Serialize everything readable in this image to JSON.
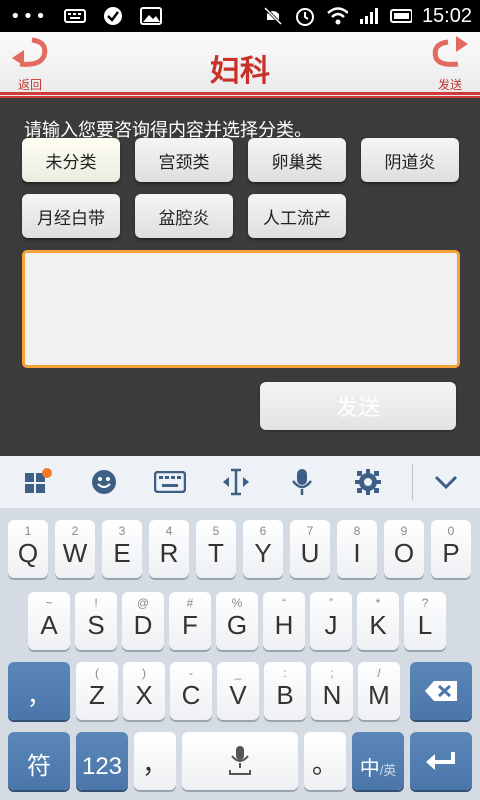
{
  "status_bar": {
    "time": "15:02",
    "dots": "•••"
  },
  "header": {
    "title": "妇科",
    "back_label": "返回",
    "send_label": "发送"
  },
  "main": {
    "prompt": "请输入您要咨询得内容并选择分类。",
    "categories": [
      "未分类",
      "宫颈类",
      "卵巢类",
      "阴道炎",
      "月经白带",
      "盆腔炎",
      "人工流产"
    ],
    "send_button": "发送",
    "input_value": ""
  },
  "keyboard": {
    "row1": [
      {
        "m": "Q",
        "s": "1"
      },
      {
        "m": "W",
        "s": "2"
      },
      {
        "m": "E",
        "s": "3"
      },
      {
        "m": "R",
        "s": "4"
      },
      {
        "m": "T",
        "s": "5"
      },
      {
        "m": "Y",
        "s": "6"
      },
      {
        "m": "U",
        "s": "7"
      },
      {
        "m": "I",
        "s": "8"
      },
      {
        "m": "O",
        "s": "9"
      },
      {
        "m": "P",
        "s": "0"
      }
    ],
    "row2": [
      {
        "m": "A",
        "s": "~"
      },
      {
        "m": "S",
        "s": "!"
      },
      {
        "m": "D",
        "s": "@"
      },
      {
        "m": "F",
        "s": "#"
      },
      {
        "m": "G",
        "s": "%"
      },
      {
        "m": "H",
        "s": "“"
      },
      {
        "m": "J",
        "s": "”"
      },
      {
        "m": "K",
        "s": "*"
      },
      {
        "m": "L",
        "s": "?"
      }
    ],
    "row3": [
      {
        "m": "Z",
        "s": "("
      },
      {
        "m": "X",
        "s": ")"
      },
      {
        "m": "C",
        "s": "-"
      },
      {
        "m": "V",
        "s": "_"
      },
      {
        "m": "B",
        "s": ":"
      },
      {
        "m": "N",
        "s": ";"
      },
      {
        "m": "M",
        "s": "/"
      }
    ],
    "comma_key": "，",
    "symbols_key": "符",
    "numbers_key": "123",
    "comma2_key": "，",
    "period_key": "。",
    "lang_key": "中",
    "lang_sub": "/英"
  },
  "colors": {
    "accent": "#c8302a",
    "input_border": "#f6a23b",
    "key_dark": "#4a76a9"
  }
}
